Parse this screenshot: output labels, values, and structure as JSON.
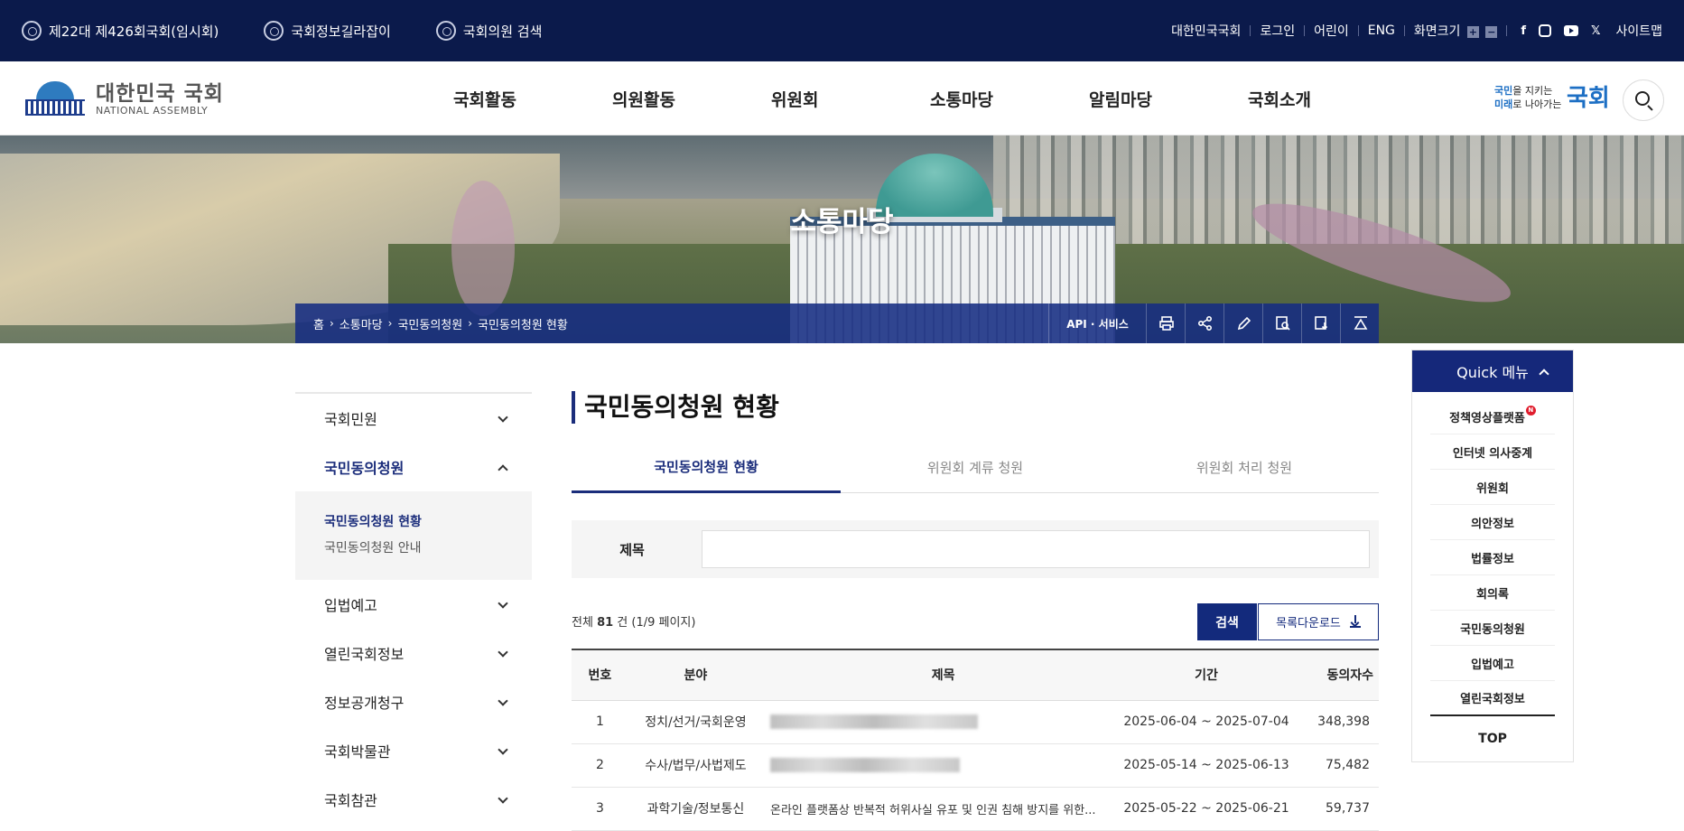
{
  "topbar": {
    "left_links": [
      "제22대 제426회국회(임시회)",
      "국회정보길라잡이",
      "국회의원 검색"
    ],
    "right_links": [
      "대한민국국회",
      "로그인",
      "어린이",
      "ENG"
    ],
    "zoom_label": "화면크기",
    "zoom_in": "+",
    "zoom_out": "−",
    "social_icons": [
      "facebook-icon",
      "instagram-icon",
      "youtube-icon",
      "x-icon"
    ],
    "sitemap": "사이트맵"
  },
  "header": {
    "logo_ko": "대한민국 국회",
    "logo_en": "NATIONAL ASSEMBLY",
    "gnb": [
      "국회활동",
      "의원활동",
      "위원회",
      "소통마당",
      "알림마당",
      "국회소개"
    ],
    "slogan_line1_highlight": "국민",
    "slogan_line1_rest": "을 지키는",
    "slogan_line2_highlight": "미래",
    "slogan_line2_rest": "로 나아가는",
    "slogan_big": "국회"
  },
  "hero": {
    "title": "소통마당",
    "breadcrumb": [
      "홈",
      "소통마당",
      "국민동의청원",
      "국민동의청원 현황"
    ],
    "api_label": "API · 서비스",
    "tools": [
      "print-icon",
      "share-icon",
      "edit-icon",
      "search-doc-icon",
      "download-doc-icon",
      "top-arrow-icon"
    ]
  },
  "lnb": {
    "items": [
      {
        "label": "국회민원"
      },
      {
        "label": "국민동의청원"
      },
      {
        "label": "입법예고"
      },
      {
        "label": "열린국회정보"
      },
      {
        "label": "정보공개청구"
      },
      {
        "label": "국회박물관"
      },
      {
        "label": "국회참관"
      }
    ],
    "sub": [
      "국민동의청원 현황",
      "국민동의청원 안내"
    ]
  },
  "content": {
    "title": "국민동의청원 현황",
    "tabs": [
      "국민동의청원 현황",
      "위원회 계류 청원",
      "위원회 처리 청원"
    ],
    "filter_label": "제목",
    "filter_value": "",
    "count_prefix": "전체",
    "count_num": "81",
    "count_suffix": "건 (1/9 페이지)",
    "search_button": "검색",
    "download_button": "목록다운로드",
    "table": {
      "headers": [
        "번호",
        "분야",
        "제목",
        "기간",
        "동의자수"
      ],
      "rows": [
        {
          "no": "1",
          "field": "정치/선거/국회운영",
          "title": "",
          "period": "2025-06-04 ~ 2025-07-04",
          "count": "348,398"
        },
        {
          "no": "2",
          "field": "수사/법무/사법제도",
          "title": "",
          "period": "2025-05-14 ~ 2025-06-13",
          "count": "75,482"
        },
        {
          "no": "3",
          "field": "과학기술/정보통신",
          "title": "온라인 플랫폼상 반복적 허위사실 유포 및 인권 침해 방지를 위한...",
          "period": "2025-05-22 ~ 2025-06-21",
          "count": "59,737"
        }
      ]
    }
  },
  "quick": {
    "title": "Quick 메뉴",
    "items": [
      "정책영상플랫폼",
      "인터넷 의사중계",
      "위원회",
      "의안정보",
      "법률정보",
      "회의록",
      "국민동의청원",
      "입법예고",
      "열린국회정보"
    ],
    "new_badge": "N",
    "top": "TOP"
  },
  "colors": {
    "navy": "#0b1a4b",
    "primary": "#15287a",
    "accent_blue": "#1d6fc4",
    "new_badge": "#e01e2e"
  }
}
